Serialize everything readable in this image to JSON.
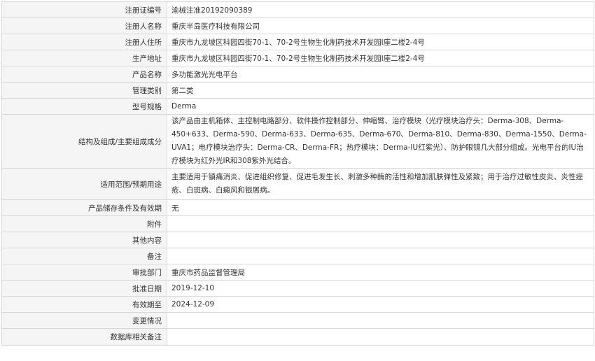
{
  "rows": [
    {
      "label": "注册证编号",
      "value": "渝械注准20192090389"
    },
    {
      "label": "注册人名称",
      "value": "重庆半岛医疗科技有限公司"
    },
    {
      "label": "注册人住所",
      "value": "重庆市九龙坡区科园四街70-1、70-2号生物生化制药技术开发园Ⅰ座二楼2-4号"
    },
    {
      "label": "生产地址",
      "value": "重庆市九龙坡区科园四街70-1、70-2号生物生化制药技术开发园Ⅰ座二楼2-4号"
    },
    {
      "label": "产品名称",
      "value": "多功能激光光电平台"
    },
    {
      "label": "管理类别",
      "value": "第二类"
    },
    {
      "label": "型号规格",
      "value": "Derma"
    },
    {
      "label": "结构及组成/主要组成成分",
      "value": "该产品由主机箱体、主控制电路部分、软件操作控制部分、伸缩臂、治疗模块（光疗模块治疗头：Derma-308、Derma-450+633、Derma-590、Derma-633、Derma-635、Derma-670、Derma-810、Derma-830、Derma-1550、Derma-UVA1；电疗模块治疗头：Derma-CR、Derma-FR；热疗模块：Derma-IU红紫光）、防护眼镜几大部分组成。光电平台的IU治疗模块为红外光IR和308紫外光结合。"
    },
    {
      "label": "适用范围/预期用途",
      "value": "主要适用于镇痛消炎、促进组织修复、促进毛发生长、刺激多种酶的活性和增加肌肤弹性及紧致；用于治疗过敏性皮炎、炎性痤疮、白斑病、白癜风和银屑病。"
    },
    {
      "label": "产品储存条件及有效期",
      "value": "无"
    },
    {
      "label": "附件",
      "value": ""
    },
    {
      "label": "其他内容",
      "value": ""
    },
    {
      "label": "备注",
      "value": ""
    },
    {
      "label": "审批部门",
      "value": "重庆市药品监督管理局"
    },
    {
      "label": "批准日期",
      "value": "2019-12-10"
    },
    {
      "label": "有效期至",
      "value": "2024-12-09"
    },
    {
      "label": "变更情况",
      "value": ""
    },
    {
      "label": "数据库相关备注",
      "value": ""
    }
  ]
}
